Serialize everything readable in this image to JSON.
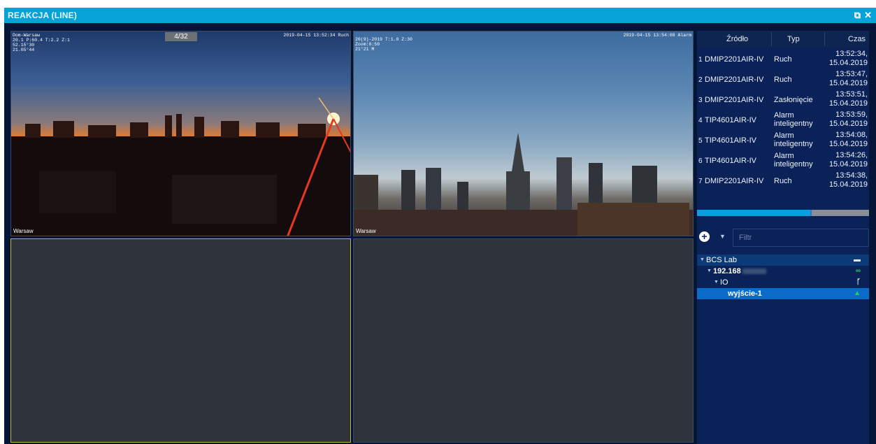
{
  "window": {
    "title": "REAKCJA (LINE)",
    "restore_icon": "restore-window-icon",
    "close_icon": "close-icon"
  },
  "cameras": [
    {
      "label": "Warsaw",
      "counter": "4/32",
      "osd_left": "Dom-Warsaw\n20.1 P:60.4 T:2.2 Z:1\n52.15°30\n21.05°44",
      "osd_right": "2019-04-15 13:52:34 Ruch"
    },
    {
      "label": "Warsaw",
      "osd_left": "20(9)-2019 T:1.0 Z:30\nZoom:0:50\n21°21 M",
      "osd_right": "2019-04-15 13:54:08 Alarm"
    },
    {
      "label": ""
    },
    {
      "label": ""
    }
  ],
  "events": {
    "columns": [
      "Źródło",
      "Typ",
      "Czas"
    ],
    "rows": [
      {
        "n": "1",
        "source": "DMIP2201AIR-IV",
        "type": "Ruch",
        "time": "13:52:34,",
        "date": "15.04.2019"
      },
      {
        "n": "2",
        "source": "DMIP2201AIR-IV",
        "type": "Ruch",
        "time": "13:53:47,",
        "date": "15.04.2019"
      },
      {
        "n": "3",
        "source": "DMIP2201AIR-IV",
        "type": "Zasłonięcie",
        "time": "13:53:51,",
        "date": "15.04.2019"
      },
      {
        "n": "4",
        "source": "TIP4601AIR-IV",
        "type": "Alarm",
        "type2": "inteligentny",
        "time": "13:53:59,",
        "date": "15.04.2019"
      },
      {
        "n": "5",
        "source": "TIP4601AIR-IV",
        "type": "Alarm",
        "type2": "inteligentny",
        "time": "13:54:08,",
        "date": "15.04.2019"
      },
      {
        "n": "6",
        "source": "TIP4601AIR-IV",
        "type": "Alarm",
        "type2": "inteligentny",
        "time": "13:54:26,",
        "date": "15.04.2019"
      },
      {
        "n": "7",
        "source": "DMIP2201AIR-IV",
        "type": "Ruch",
        "time": "13:54:38,",
        "date": "15.04.2019"
      }
    ]
  },
  "progress": {
    "value": 0.66,
    "color": "#0d9de0"
  },
  "filter": {
    "placeholder": "Filtr",
    "value": "",
    "add_icon": "plus-circle-icon",
    "dropdown_icon": "chevron-down-icon"
  },
  "tree": {
    "root": {
      "label": "BCS Lab",
      "icon": "folder-icon"
    },
    "device": {
      "label": "192.168",
      "icon": "cassette-icon"
    },
    "group": {
      "label": "IO",
      "icon": "branch-icon"
    },
    "output": {
      "label": "wyjście-1",
      "icon": "alarm-siren-icon"
    }
  },
  "colors": {
    "titlebar": "#07a2d6",
    "background": "#041538",
    "panel": "#0a2258",
    "selected_row": "#0a6cc8",
    "active_cell_border": "#c9b733",
    "status_green": "#27d05a"
  }
}
